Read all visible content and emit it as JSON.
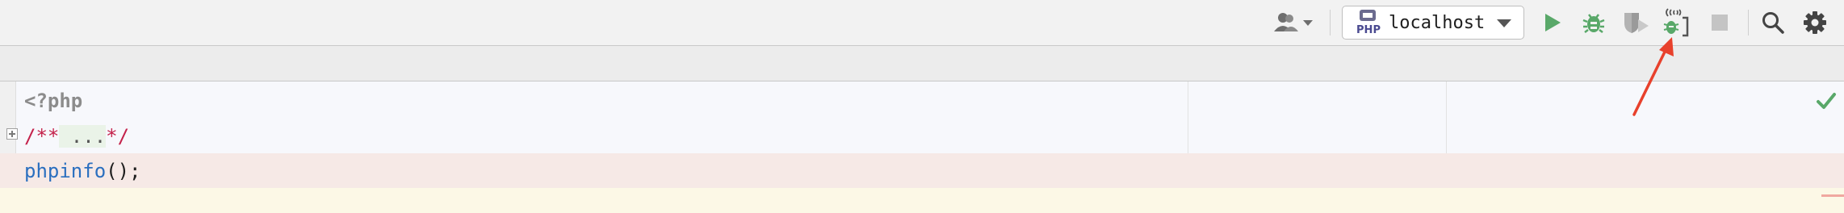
{
  "toolbar": {
    "run_configuration": {
      "label": "localhost",
      "icon": "php-icon",
      "icon_text": "PHP",
      "dropdown_icon": "chevron-down-icon"
    },
    "buttons": [
      {
        "name": "user-accounts-button",
        "icon": "user-icon"
      },
      {
        "name": "run-button",
        "icon": "play-icon",
        "color": "#59a869"
      },
      {
        "name": "debug-button",
        "icon": "bug-icon",
        "color": "#59a869"
      },
      {
        "name": "run-with-coverage-button",
        "icon": "coverage-icon",
        "state": "disabled"
      },
      {
        "name": "listen-php-debug-connections-button",
        "icon": "listen-debug-icon",
        "color": "#59a869"
      },
      {
        "name": "stop-button",
        "icon": "stop-icon",
        "state": "disabled"
      },
      {
        "name": "search-everywhere-button",
        "icon": "search-icon"
      },
      {
        "name": "settings-button",
        "icon": "gear-icon"
      }
    ]
  },
  "editor": {
    "lines": [
      {
        "tokens": [
          {
            "type": "tag",
            "text": "<?php"
          }
        ]
      },
      {
        "tokens": [
          {
            "type": "comment",
            "text": "/**"
          },
          {
            "type": "folded",
            "text": " ..."
          },
          {
            "type": "comment",
            "text": "*/"
          }
        ]
      },
      {
        "tokens": [
          {
            "type": "func",
            "text": "phpinfo"
          },
          {
            "type": "punc",
            "text": "();"
          }
        ],
        "highlight": "breakpoint"
      },
      {
        "tokens": [],
        "highlight": "current"
      }
    ]
  },
  "colors": {
    "accent_green": "#59a869",
    "annotation_arrow": "#e8412c",
    "comment": "#c4224b",
    "function": "#2b6fbf"
  }
}
